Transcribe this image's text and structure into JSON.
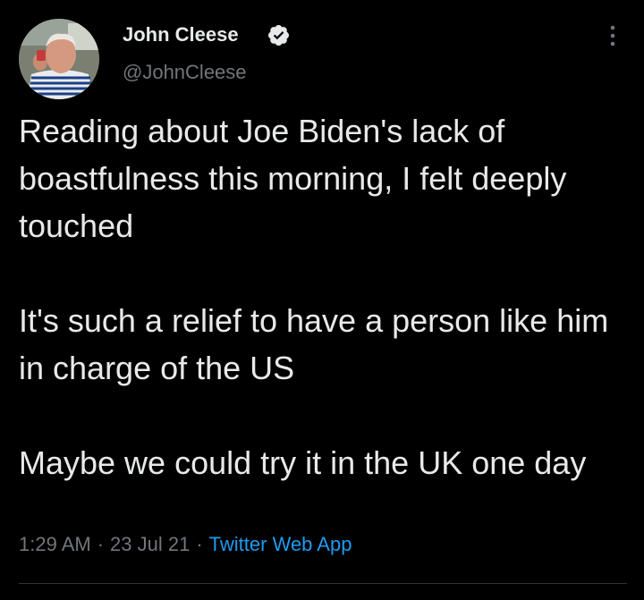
{
  "author": {
    "name": "John Cleese",
    "handle": "@JohnCleese",
    "verified": true
  },
  "tweet": {
    "paragraphs": [
      "Reading about Joe Biden's lack of boastfulness this morning, I felt deeply touched",
      "It's such a relief to have a person like him in charge of the US",
      "Maybe we could try it in the UK one day"
    ],
    "time": "1:29 AM",
    "date": "23 Jul 21",
    "source": "Twitter Web App",
    "separator": "·"
  },
  "colors": {
    "background": "#000000",
    "text": "#e7e9ea",
    "secondary": "#71767b",
    "accent": "#1d9bf0"
  },
  "icons": {
    "verified": "verified-badge-icon",
    "more": "more-options-icon"
  }
}
